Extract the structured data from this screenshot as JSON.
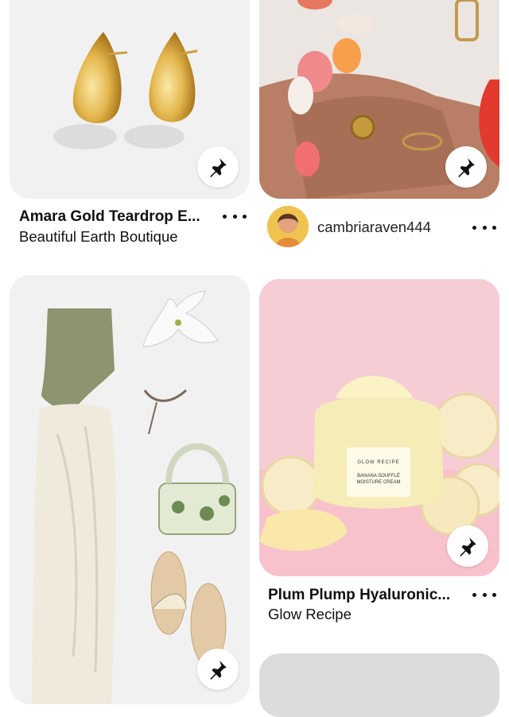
{
  "pins": [
    {
      "title": "Amara Gold Teardrop E...",
      "subtitle": "Beautiful Earth Boutique"
    },
    {
      "username": "cambriaraven444"
    },
    {},
    {
      "title": "Plum Plump Hyaluronic...",
      "subtitle": "Glow Recipe",
      "jar_brand": "GLOW RECIPE",
      "jar_product": "BANANA SOUFFLÉ MOISTURE CREAM"
    }
  ],
  "colors": {
    "card_bg": "#f1f1f1",
    "pink_bg": "#f6c9d1"
  }
}
